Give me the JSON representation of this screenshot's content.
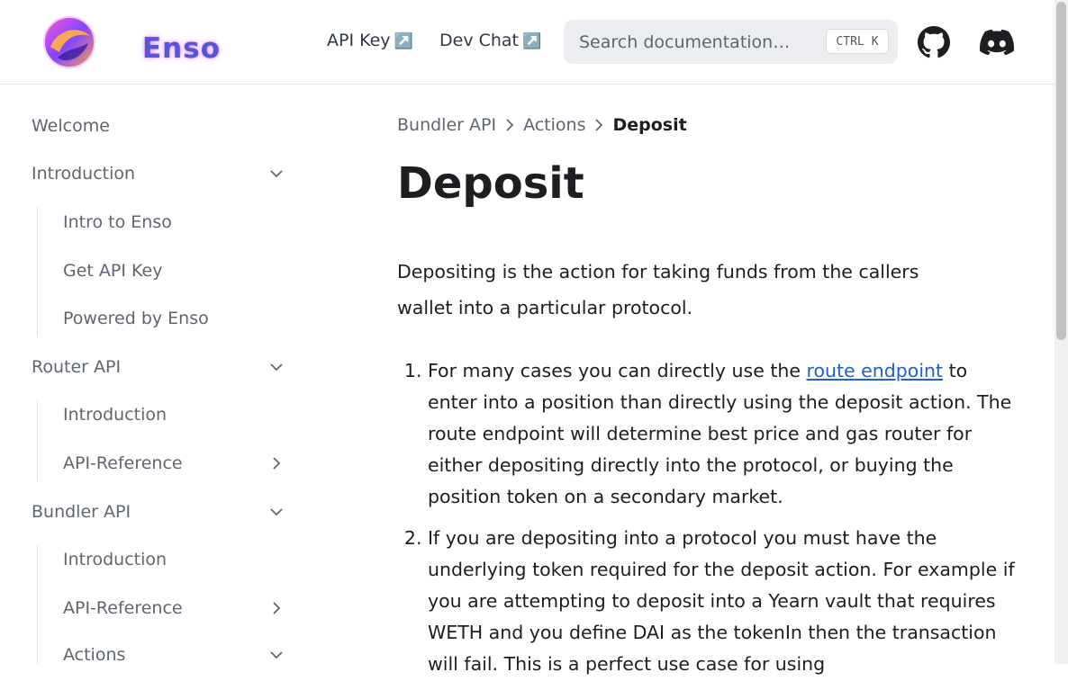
{
  "header": {
    "logo_text": "Enso",
    "links": [
      {
        "label": "API Key",
        "ext": "↗️"
      },
      {
        "label": "Dev Chat",
        "ext": "↗️"
      }
    ],
    "search": {
      "placeholder": "Search documentation…",
      "kbd_ctrl": "CTRL",
      "kbd_key": "K"
    },
    "icons": [
      "github-icon",
      "discord-icon"
    ]
  },
  "sidebar": {
    "items": [
      {
        "label": "Welcome"
      },
      {
        "label": "Introduction",
        "expanded": true
      },
      {
        "label": "Intro to Enso"
      },
      {
        "label": "Get API Key"
      },
      {
        "label": "Powered by Enso"
      },
      {
        "label": "Router API",
        "expanded": true
      },
      {
        "label": "Introduction"
      },
      {
        "label": "API-Reference",
        "expanded": false
      },
      {
        "label": "Bundler API",
        "expanded": true
      },
      {
        "label": "Introduction"
      },
      {
        "label": "API-Reference",
        "expanded": false
      },
      {
        "label": "Actions",
        "expanded": true
      }
    ]
  },
  "breadcrumbs": [
    "Bundler API",
    "Actions",
    "Deposit"
  ],
  "main": {
    "title": "Deposit",
    "lead": "Depositing is the action for taking funds from the callers wallet into a particular protocol.",
    "steps": [
      {
        "before": "For many cases you can directly use the ",
        "link": "route endpoint",
        "after": " to enter into a position than directly using the deposit action. The route endpoint will determine best price and gas router for either depositing directly into the protocol, or buying the position token on a secondary market."
      },
      {
        "before": "If you are depositing into a protocol you must have the underlying token required for the deposit action. For example if you are attempting to deposit into a Yearn vault that requires WETH and you define DAI as the tokenIn then the transaction will fail. This is a perfect use case for using",
        "link": "",
        "after": ""
      }
    ]
  },
  "colors": {
    "link": "#1e5fd4",
    "text": "#1c1e21",
    "muted": "#5f6670"
  }
}
